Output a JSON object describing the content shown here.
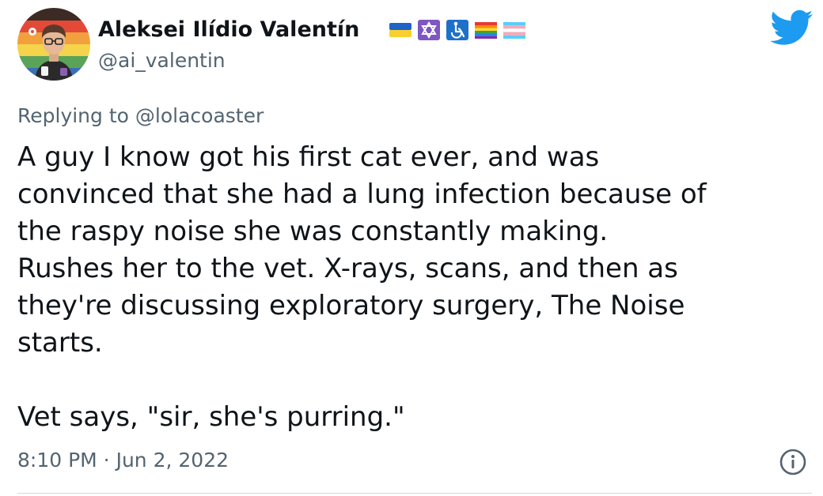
{
  "author": {
    "display_name": "Aleksei Ilídio Valentín",
    "handle": "@ai_valentin",
    "avatar_icon": "avatar-pride-background",
    "flag_icons": [
      "ukraine-flag-icon",
      "star-of-david-icon",
      "accessibility-icon",
      "rainbow-pride-flag-icon",
      "transgender-flag-icon"
    ]
  },
  "reply": {
    "prefix": "Replying to",
    "mention": "@lolacoaster"
  },
  "tweet": {
    "text": "A guy I know got his first cat ever, and was\nconvinced that she had a lung infection because of\nthe raspy noise she was constantly making.\nRushes her to the vet. X-rays, scans, and then as\nthey're discussing exploratory surgery, The Noise\nstarts.\n\nVet says, \"sir, she's purring.\"",
    "timestamp": "8:10 PM · Jun 2, 2022"
  },
  "colors": {
    "text_primary": "#0f1419",
    "text_secondary": "#536471",
    "twitter_blue": "#1d9bf0",
    "divider": "#cfd9de"
  },
  "icons": {
    "brand": "twitter-bird-icon",
    "info": "info-circle-icon"
  }
}
